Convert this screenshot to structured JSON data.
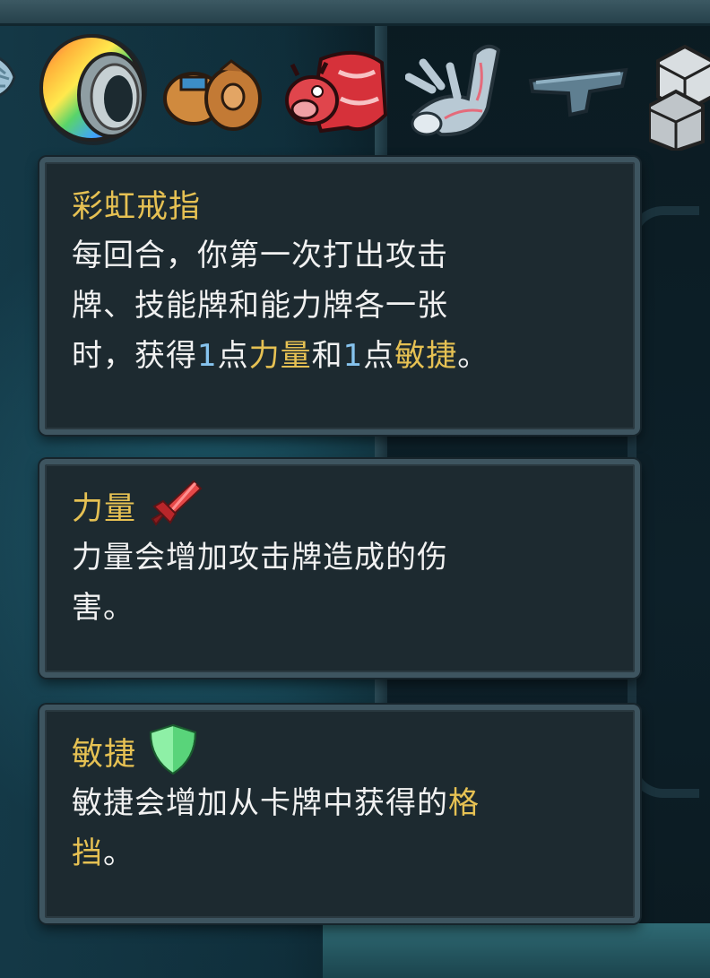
{
  "relics": [
    {
      "name": "shell-relic-icon"
    },
    {
      "name": "rainbow-ring-relic-icon"
    },
    {
      "name": "jar-relic-icon"
    },
    {
      "name": "red-bull-relic-icon"
    },
    {
      "name": "coral-relic-icon"
    },
    {
      "name": "anvil-relic-icon"
    },
    {
      "name": "cube-relic-icon"
    }
  ],
  "tooltips": {
    "ring": {
      "title": "彩虹戒指",
      "line1": "每回合，你第一次打出攻击",
      "line2": "牌、技能牌和能力牌各一张",
      "line3_a": "时，获得",
      "line3_num1": "1",
      "line3_b": "点",
      "line3_kw1": "力量",
      "line3_c": "和",
      "line3_num2": "1",
      "line3_d": "点",
      "line3_kw2": "敏捷",
      "line3_e": "。"
    },
    "strength": {
      "title": "力量",
      "icon": "sword-icon",
      "line1": "力量会增加攻击牌造成的伤",
      "line2": "害。"
    },
    "dexterity": {
      "title": "敏捷",
      "icon": "shield-icon",
      "line1_a": "敏捷会增加从卡牌中获得的",
      "line1_kw": "格",
      "line2_kw": "挡",
      "line2_b": "。"
    }
  },
  "colors": {
    "keyword": "#e6c153",
    "number": "#86c3ee",
    "body_text": "#f1f1f1",
    "panel_bg": "#1d2a30",
    "panel_border": "#3e5560"
  }
}
